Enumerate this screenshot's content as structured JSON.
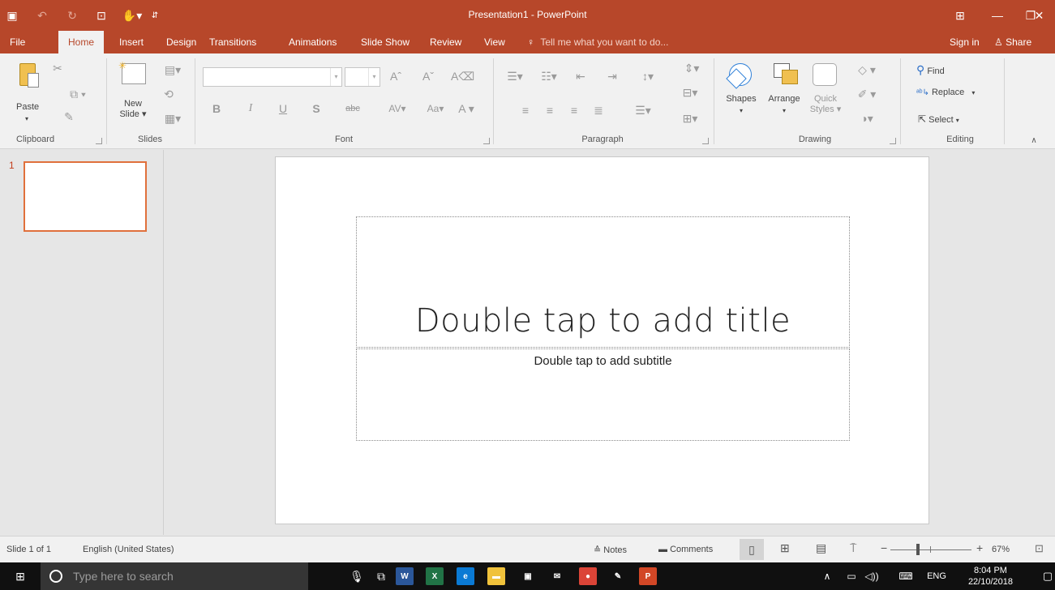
{
  "window": {
    "title": "Presentation1 - PowerPoint",
    "controls": [
      "ribbon-display-icon",
      "minimize-icon",
      "restore-icon",
      "close-icon"
    ]
  },
  "quick_access": [
    "save-icon",
    "undo-icon",
    "redo-icon",
    "touch-mode-icon",
    "mouse-mode-icon",
    "customize-qat-icon"
  ],
  "tabs": [
    {
      "label": "File"
    },
    {
      "label": "Home",
      "active": true
    },
    {
      "label": "Insert"
    },
    {
      "label": "Design"
    },
    {
      "label": "Transitions"
    },
    {
      "label": "Animations"
    },
    {
      "label": "Slide Show"
    },
    {
      "label": "Review"
    },
    {
      "label": "View"
    }
  ],
  "tell_me": "Tell me what you want to do...",
  "sign_in": "Sign in",
  "share": "Share",
  "ribbon": {
    "clipboard": {
      "label": "Clipboard",
      "paste": "Paste"
    },
    "slides": {
      "label": "Slides",
      "new_slide": "New",
      "new_slide2": "Slide"
    },
    "font": {
      "label": "Font"
    },
    "paragraph": {
      "label": "Paragraph"
    },
    "drawing": {
      "label": "Drawing",
      "shapes": "Shapes",
      "arrange": "Arrange",
      "quick_styles": "Quick",
      "quick_styles2": "Styles"
    },
    "editing": {
      "label": "Editing",
      "find": "Find",
      "replace": "Replace",
      "select": "Select"
    }
  },
  "thumbnails": [
    {
      "number": "1"
    }
  ],
  "slide": {
    "title_placeholder": "Double tap to add title",
    "subtitle_placeholder": "Double tap to add subtitle"
  },
  "status": {
    "slide_info": "Slide 1 of 1",
    "language": "English (United States)",
    "notes": "Notes",
    "comments": "Comments",
    "zoom_level": "67%",
    "zoom_fraction": 0.67
  },
  "taskbar": {
    "search_placeholder": "Type here to search",
    "apps": [
      {
        "name": "word",
        "label": "W",
        "color": "#2b579a"
      },
      {
        "name": "excel",
        "label": "X",
        "color": "#217346"
      },
      {
        "name": "edge",
        "label": "e",
        "color": "#0a7ad4"
      },
      {
        "name": "explorer",
        "label": "▬",
        "color": "#f0c23b"
      },
      {
        "name": "store",
        "label": "▣",
        "color": "#101010"
      },
      {
        "name": "mail",
        "label": "✉",
        "color": "#101010"
      },
      {
        "name": "chrome",
        "label": "●",
        "color": "#db4437"
      },
      {
        "name": "paint",
        "label": "✎",
        "color": "#101010"
      },
      {
        "name": "powerpoint",
        "label": "P",
        "color": "#d24726"
      }
    ],
    "language": "ENG",
    "time": "8:04 PM",
    "date": "22/10/2018"
  }
}
